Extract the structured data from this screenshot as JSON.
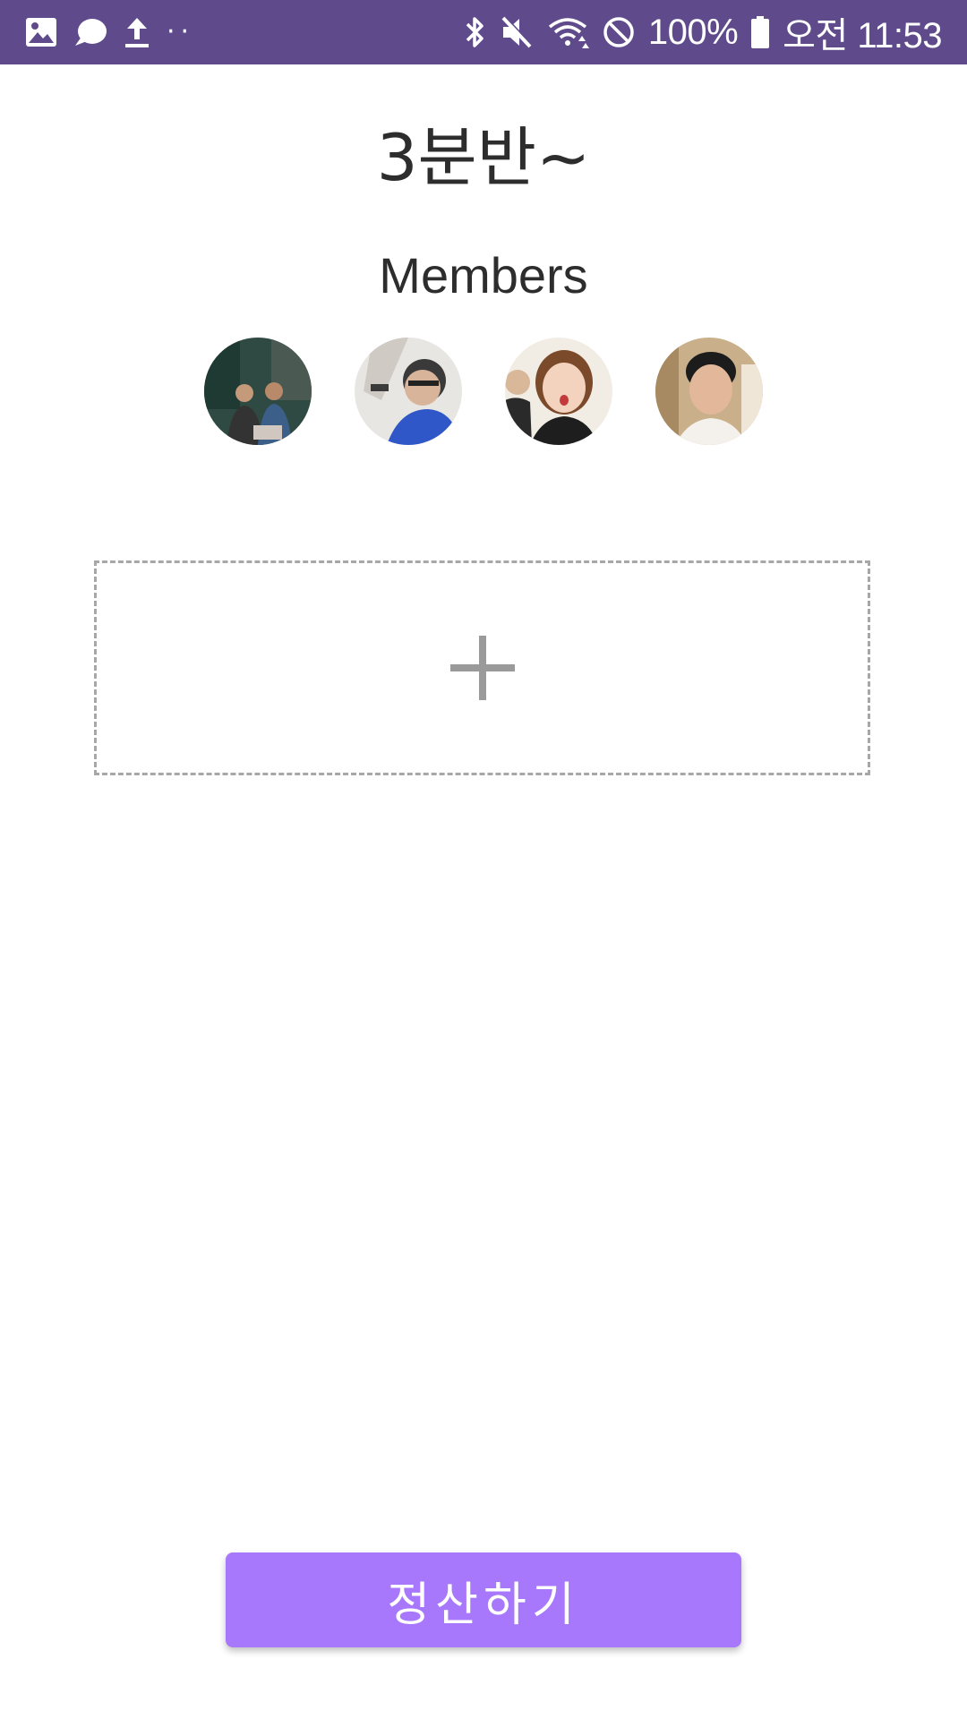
{
  "status_bar": {
    "battery": "100%",
    "time": "오전 11:53",
    "background_color": "#5f4b8b",
    "left_icons": [
      "gallery-icon",
      "chat-bubble-icon",
      "upload-icon",
      "more-dots-icon"
    ],
    "right_icons": [
      "bluetooth-icon",
      "mute-icon",
      "wifi-icon",
      "no-disturb-icon",
      "battery-icon"
    ]
  },
  "group": {
    "title": "3분반~"
  },
  "members": {
    "heading": "Members",
    "avatars": [
      "member-avatar-1",
      "member-avatar-2",
      "member-avatar-3",
      "member-avatar-4"
    ]
  },
  "add_section": {
    "icon": "plus-icon"
  },
  "settle_button": {
    "label": "정산하기",
    "color": "#a878fc"
  }
}
